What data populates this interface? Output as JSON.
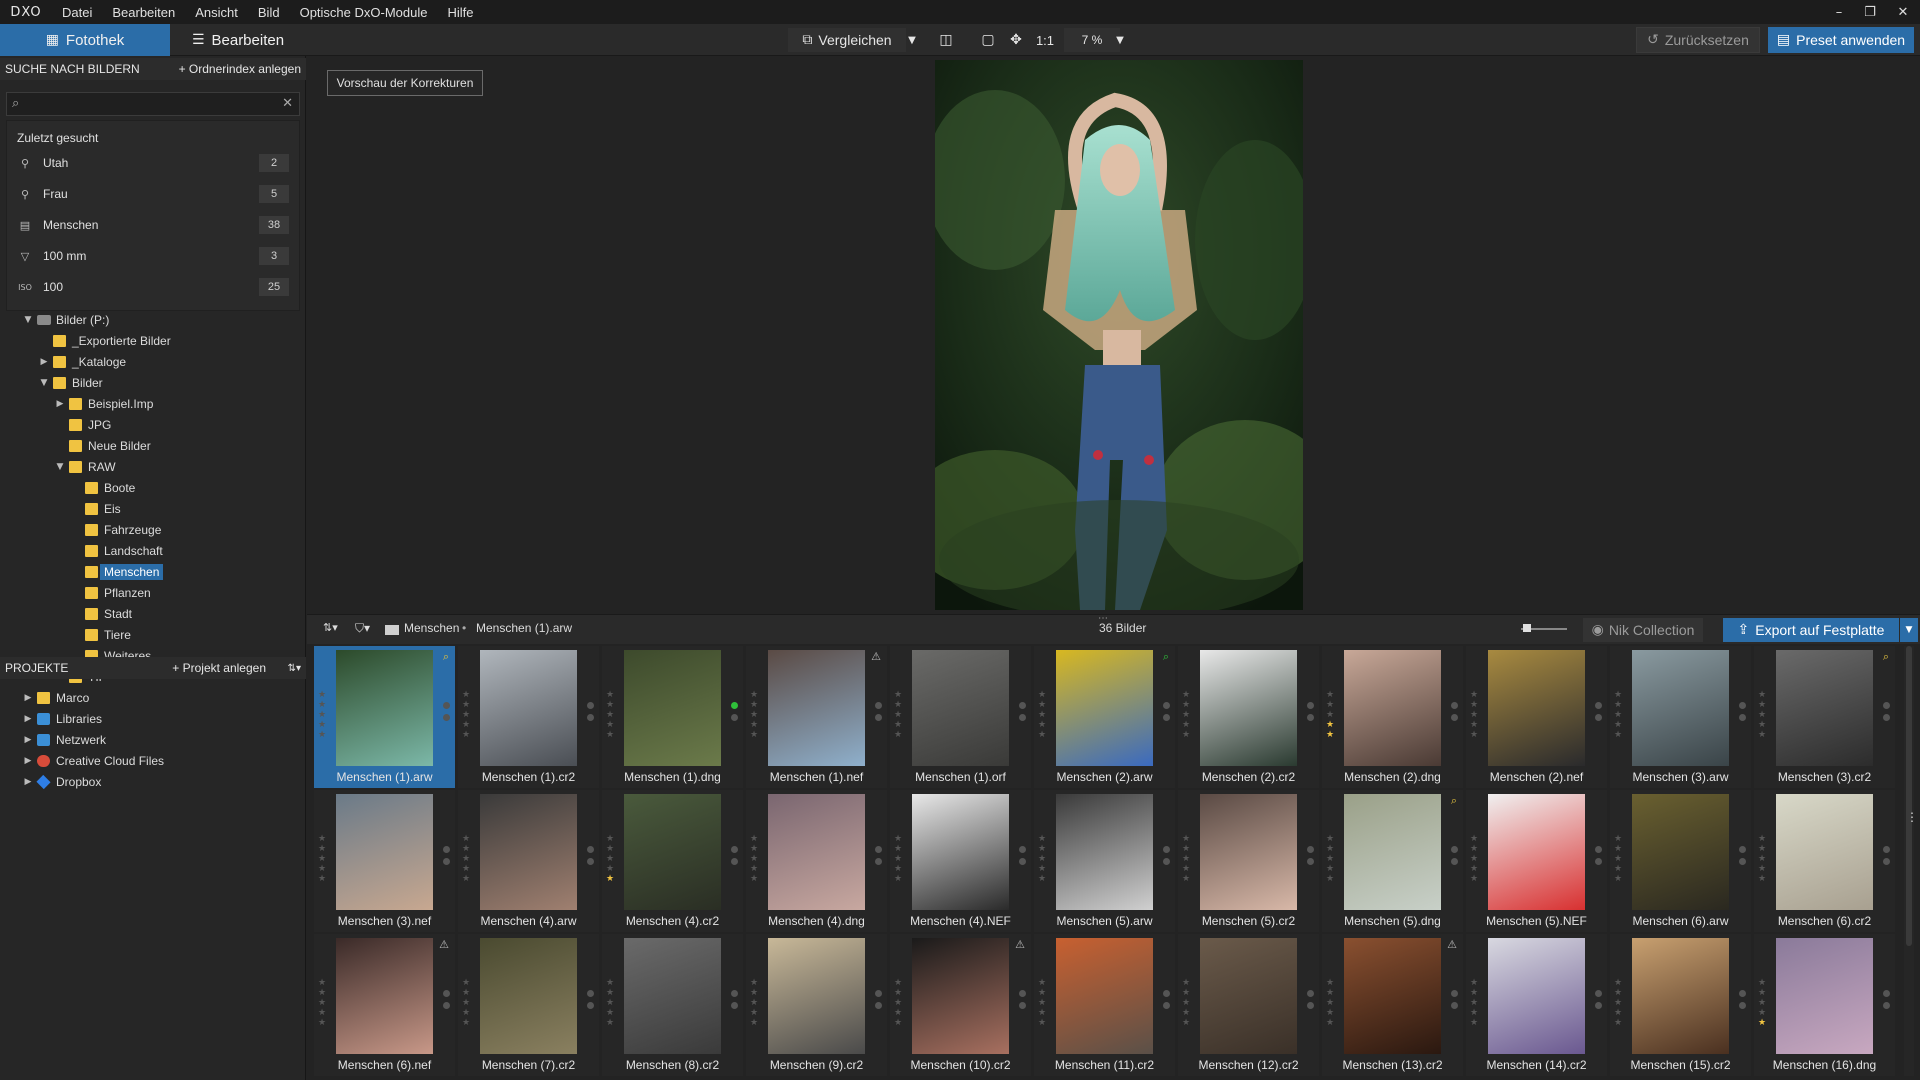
{
  "app": {
    "logo": "DXO"
  },
  "menu": [
    "Datei",
    "Bearbeiten",
    "Ansicht",
    "Bild",
    "Optische DxO-Module",
    "Hilfe"
  ],
  "toolbar": {
    "tab_fotothek": "Fotothek",
    "tab_bearbeiten": "Bearbeiten",
    "compare": "Vergleichen",
    "zoom_1to1": "1:1",
    "zoom": "7 %",
    "reset": "Zurücksetzen",
    "apply_preset": "Preset anwenden"
  },
  "search": {
    "section_title": "SUCHE NACH BILDERN",
    "add_index": "+ Ordnerindex anlegen",
    "value": "",
    "recent_title": "Zuletzt gesucht",
    "recent": [
      {
        "icon": "location-icon",
        "label": "Utah",
        "count": "2"
      },
      {
        "icon": "location-icon",
        "label": "Frau",
        "count": "5"
      },
      {
        "icon": "document-icon",
        "label": "Menschen",
        "count": "38"
      },
      {
        "icon": "lens-icon",
        "label": "100 mm",
        "count": "3"
      },
      {
        "icon": "iso-icon",
        "label": "100",
        "count": "25"
      }
    ]
  },
  "tree": [
    {
      "label": "Bilder (P:)",
      "level": 0,
      "type": "drive",
      "expanded": true
    },
    {
      "label": "_Exportierte Bilder",
      "level": 1,
      "type": "folder"
    },
    {
      "label": "_Kataloge",
      "level": 1,
      "type": "folder",
      "collapsed": true
    },
    {
      "label": "Bilder",
      "level": 1,
      "type": "folder",
      "expanded": true
    },
    {
      "label": "Beispiel.Imp",
      "level": 2,
      "type": "folder",
      "collapsed": true
    },
    {
      "label": "JPG",
      "level": 2,
      "type": "folder"
    },
    {
      "label": "Neue Bilder",
      "level": 2,
      "type": "folder"
    },
    {
      "label": "RAW",
      "level": 2,
      "type": "folder",
      "expanded": true
    },
    {
      "label": "Boote",
      "level": 3,
      "type": "folder"
    },
    {
      "label": "Eis",
      "level": 3,
      "type": "folder"
    },
    {
      "label": "Fahrzeuge",
      "level": 3,
      "type": "folder"
    },
    {
      "label": "Landschaft",
      "level": 3,
      "type": "folder"
    },
    {
      "label": "Menschen",
      "level": 3,
      "type": "folder",
      "selected": true
    },
    {
      "label": "Pflanzen",
      "level": 3,
      "type": "folder"
    },
    {
      "label": "Stadt",
      "level": 3,
      "type": "folder"
    },
    {
      "label": "Tiere",
      "level": 3,
      "type": "folder"
    },
    {
      "label": "Weiteres",
      "level": 3,
      "type": "folder"
    },
    {
      "label": "TIF",
      "level": 2,
      "type": "folder"
    },
    {
      "label": "Marco",
      "level": 0,
      "type": "folder",
      "collapsed": true
    },
    {
      "label": "Libraries",
      "level": 0,
      "type": "net",
      "collapsed": true
    },
    {
      "label": "Netzwerk",
      "level": 0,
      "type": "net",
      "collapsed": true
    },
    {
      "label": "Creative Cloud Files",
      "level": 0,
      "type": "cc",
      "collapsed": true
    },
    {
      "label": "Dropbox",
      "level": 0,
      "type": "db",
      "collapsed": true
    }
  ],
  "projects": {
    "title": "PROJEKTE",
    "add": "+ Projekt anlegen"
  },
  "viewer": {
    "preview_button": "Vorschau der Korrekturen"
  },
  "filmstrip": {
    "folder": "Menschen",
    "file": "Menschen (1).arw",
    "count": "36 Bilder",
    "nik": "Nik Collection",
    "export": "Export auf Festplatte"
  },
  "colors": {
    "accent": "#2b6da8",
    "star": "#f0c341",
    "green": "#2fbf3a"
  },
  "images": [
    {
      "name": "Menschen (1).arw",
      "tone": [
        "#2c4a2a",
        "#7cb8a8"
      ],
      "selected": true,
      "flag": "yellow"
    },
    {
      "name": "Menschen (1).cr2",
      "tone": [
        "#b0b6bc",
        "#4a4e54"
      ]
    },
    {
      "name": "Menschen (1).dng",
      "tone": [
        "#3d4a2c",
        "#6b7a4a"
      ],
      "dot": "green"
    },
    {
      "name": "Menschen (1).nef",
      "tone": [
        "#5a4a44",
        "#8fb0cc"
      ],
      "flag": "gray"
    },
    {
      "name": "Menschen (1).orf",
      "tone": [
        "#6a6a68",
        "#3a3a38"
      ]
    },
    {
      "name": "Menschen (2).arw",
      "tone": [
        "#d8b820",
        "#3a6ac0"
      ],
      "flag": "green"
    },
    {
      "name": "Menschen (2).cr2",
      "tone": [
        "#e8e8e8",
        "#2a3a30"
      ]
    },
    {
      "name": "Menschen (2).dng",
      "tone": [
        "#c8a898",
        "#4a3a34"
      ],
      "stars": 2
    },
    {
      "name": "Menschen (2).nef",
      "tone": [
        "#a88a40",
        "#2a2a2c"
      ]
    },
    {
      "name": "Menschen (3).arw",
      "tone": [
        "#8a9aa0",
        "#3a4448"
      ]
    },
    {
      "name": "Menschen (3).cr2",
      "tone": [
        "#6a6a6a",
        "#2c2c2c"
      ],
      "flag": "yellow"
    },
    {
      "name": "Menschen (3).nef",
      "tone": [
        "#6a7a88",
        "#c8a890"
      ]
    },
    {
      "name": "Menschen (4).arw",
      "tone": [
        "#3a3a3a",
        "#a08070"
      ]
    },
    {
      "name": "Menschen (4).cr2",
      "tone": [
        "#4a5a3c",
        "#2a2e24"
      ],
      "stars": 1
    },
    {
      "name": "Menschen (4).dng",
      "tone": [
        "#7a6670",
        "#c8a8a0"
      ]
    },
    {
      "name": "Menschen (4).NEF",
      "tone": [
        "#e8e8e8",
        "#2a2a2a"
      ]
    },
    {
      "name": "Menschen (5).arw",
      "tone": [
        "#3a3a3a",
        "#d0d0d0"
      ]
    },
    {
      "name": "Menschen (5).cr2",
      "tone": [
        "#5a4a44",
        "#d8b8a8"
      ]
    },
    {
      "name": "Menschen (5).dng",
      "tone": [
        "#9aa088",
        "#c8d0c8"
      ],
      "flag": "yellow"
    },
    {
      "name": "Menschen (5).NEF",
      "tone": [
        "#f0f0f0",
        "#d83030"
      ]
    },
    {
      "name": "Menschen (6).arw",
      "tone": [
        "#6a6030",
        "#2a2820"
      ]
    },
    {
      "name": "Menschen (6).cr2",
      "tone": [
        "#d8d8c8",
        "#a8a090"
      ]
    },
    {
      "name": "Menschen (6).nef",
      "tone": [
        "#3a2a28",
        "#c89888"
      ],
      "flag": "gray"
    },
    {
      "name": "Menschen (7).cr2",
      "tone": [
        "#4a4a30",
        "#8a8060"
      ]
    },
    {
      "name": "Menschen (8).cr2",
      "tone": [
        "#6a6a6a",
        "#3a3a3a"
      ]
    },
    {
      "name": "Menschen (9).cr2",
      "tone": [
        "#c8b898",
        "#4a4a4a"
      ]
    },
    {
      "name": "Menschen (10).cr2",
      "tone": [
        "#1a1a1a",
        "#a87060"
      ],
      "flag": "gray"
    },
    {
      "name": "Menschen (11).cr2",
      "tone": [
        "#c86030",
        "#5a5048"
      ]
    },
    {
      "name": "Menschen (12).cr2",
      "tone": [
        "#6a5a4a",
        "#3a3028"
      ]
    },
    {
      "name": "Menschen (13).cr2",
      "tone": [
        "#8a5030",
        "#2a1810"
      ],
      "flag": "gray"
    },
    {
      "name": "Menschen (14).cr2",
      "tone": [
        "#d8d8e0",
        "#6a5890"
      ]
    },
    {
      "name": "Menschen (15).cr2",
      "tone": [
        "#c8a070",
        "#4a3020"
      ]
    },
    {
      "name": "Menschen (16).dng",
      "tone": [
        "#8a7a9a",
        "#c8a8c0"
      ],
      "stars": 1
    }
  ]
}
